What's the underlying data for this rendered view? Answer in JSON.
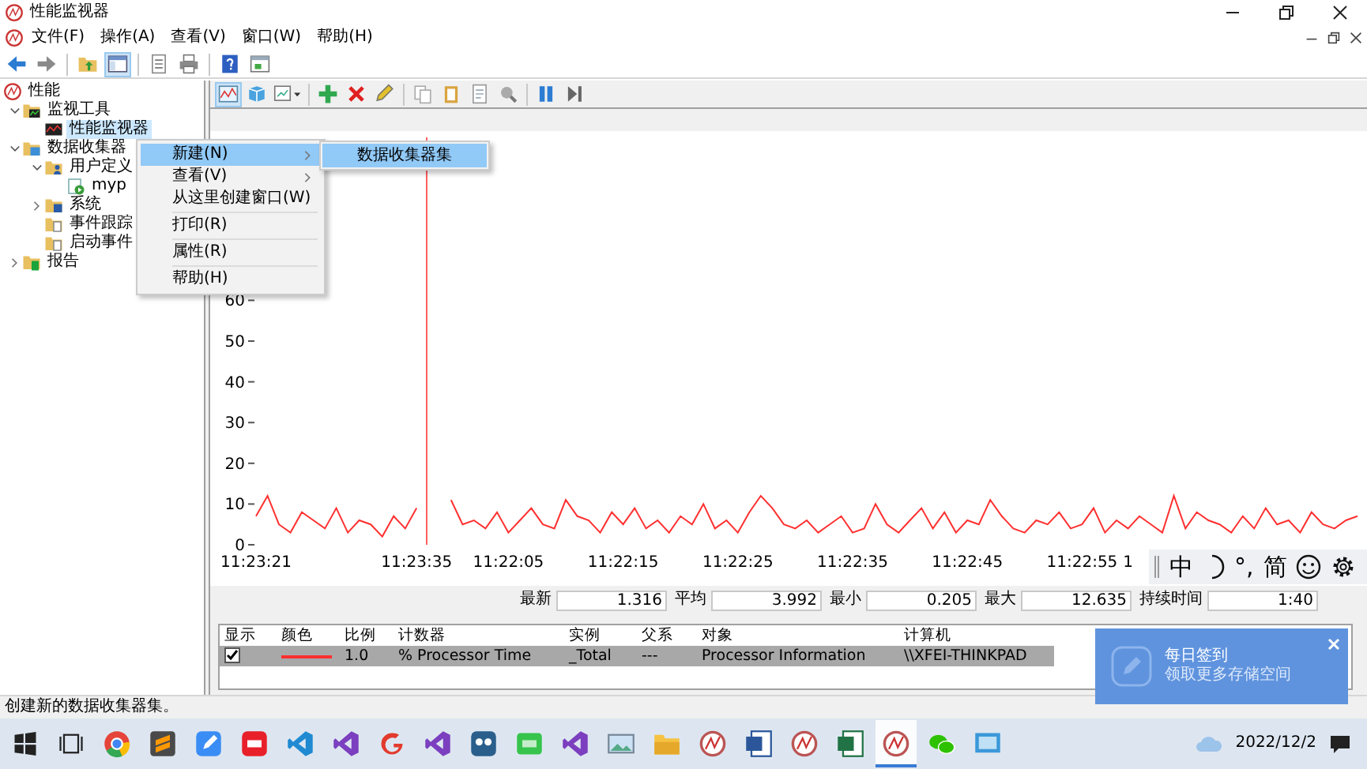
{
  "window": {
    "title": "性能监视器"
  },
  "menu": [
    "文件(F)",
    "操作(A)",
    "查看(V)",
    "窗口(W)",
    "帮助(H)"
  ],
  "main_toolbar": [
    {
      "kind": "back",
      "pressed": false
    },
    {
      "kind": "forward",
      "pressed": false
    },
    {
      "kind": "separator"
    },
    {
      "kind": "upfolder",
      "pressed": false
    },
    {
      "kind": "tree",
      "pressed": true
    },
    {
      "kind": "separator"
    },
    {
      "kind": "list",
      "pressed": false
    },
    {
      "kind": "print",
      "pressed": false
    },
    {
      "kind": "separator"
    },
    {
      "kind": "help",
      "pressed": false
    },
    {
      "kind": "mmcwin",
      "pressed": false
    }
  ],
  "tree": [
    {
      "label": "性能",
      "kind": "perf",
      "selected": false,
      "children": [
        {
          "label": "监视工具",
          "kind": "toolsfolder",
          "selected": false,
          "expanded": true,
          "children": [
            {
              "label": "性能监视器",
              "kind": "monitor",
              "selected": true
            }
          ]
        },
        {
          "label": "数据收集器",
          "kind": "datafolder",
          "selected": false,
          "expanded": true,
          "children": [
            {
              "label": "用户定义",
              "kind": "userfolder",
              "selected": false,
              "expanded": true,
              "children": [
                {
                  "label": "myp",
                  "kind": "dataset",
                  "selected": false
                }
              ]
            },
            {
              "label": "系统",
              "kind": "systemfolder",
              "selected": false,
              "expanded": false
            },
            {
              "label": "事件跟踪",
              "kind": "tracefolder",
              "selected": false
            },
            {
              "label": "启动事件",
              "kind": "tracefolder",
              "selected": false
            }
          ]
        },
        {
          "label": "报告",
          "kind": "reportfolder",
          "selected": false,
          "expanded": false
        }
      ]
    }
  ],
  "graph_toolbar": [
    {
      "kind": "graph",
      "pressed": true
    },
    {
      "kind": "freeze",
      "pressed": false
    },
    {
      "kind": "graphtype",
      "pressed": false
    },
    {
      "kind": "separator"
    },
    {
      "kind": "add",
      "pressed": false
    },
    {
      "kind": "delete",
      "pressed": false
    },
    {
      "kind": "highlight",
      "pressed": false
    },
    {
      "kind": "separator"
    },
    {
      "kind": "copy",
      "pressed": false
    },
    {
      "kind": "paste",
      "pressed": false
    },
    {
      "kind": "props",
      "pressed": false
    },
    {
      "kind": "zoom",
      "pressed": false
    },
    {
      "kind": "separator"
    },
    {
      "kind": "pause",
      "pressed": false
    },
    {
      "kind": "step",
      "pressed": false
    }
  ],
  "graph": {
    "chart_data": {
      "type": "line",
      "ylim": [
        0,
        100
      ],
      "categories": [
        "11:23:21",
        null,
        null,
        null,
        null,
        null,
        null,
        null,
        null,
        null,
        null,
        null,
        null,
        null,
        "11:23:35",
        null,
        null,
        null,
        null,
        null,
        null,
        null,
        "11:22:05",
        null,
        null,
        null,
        null,
        null,
        null,
        null,
        null,
        null,
        "11:22:15",
        null,
        null,
        null,
        null,
        null,
        null,
        null,
        null,
        null,
        "11:22:25",
        null,
        null,
        null,
        null,
        null,
        null,
        null,
        null,
        null,
        "11:22:35",
        null,
        null,
        null,
        null,
        null,
        null,
        null,
        null,
        null,
        "11:22:45",
        null,
        null,
        null,
        null,
        null,
        null,
        null,
        null,
        null,
        "11:22:55",
        null,
        null,
        null,
        "1",
        null,
        null,
        null,
        null,
        null,
        null,
        null,
        null,
        null,
        null,
        null,
        null,
        null,
        null,
        null,
        null,
        null,
        null,
        null,
        null
      ],
      "yticks": [
        0,
        10,
        20,
        30,
        40,
        50,
        60
      ],
      "series": [
        {
          "color": "#ff3030",
          "values": [
            7,
            12,
            5,
            3,
            8,
            6,
            4,
            9,
            3,
            6,
            5,
            2,
            7,
            4,
            9,
            null,
            null,
            11,
            5,
            6,
            4,
            8,
            3,
            6,
            9,
            5,
            4,
            11,
            7,
            6,
            3,
            8,
            5,
            9,
            4,
            6,
            3,
            7,
            5,
            10,
            4,
            6,
            3,
            8,
            12,
            9,
            5,
            4,
            6,
            3,
            5,
            7,
            3,
            4,
            10,
            5,
            3,
            6,
            9,
            4,
            8,
            3,
            6,
            5,
            11,
            7,
            4,
            3,
            6,
            5,
            8,
            4,
            5,
            9,
            3,
            6,
            4,
            7,
            5,
            3,
            12,
            4,
            8,
            6,
            5,
            3,
            7,
            4,
            9,
            5,
            6,
            3,
            8,
            5,
            4,
            6,
            7
          ]
        }
      ]
    }
  },
  "stats": [
    {
      "label": "最新",
      "value": "1.316"
    },
    {
      "label": "平均",
      "value": "3.992"
    },
    {
      "label": "最小",
      "value": "0.205"
    },
    {
      "label": "最大",
      "value": "12.635"
    },
    {
      "label": "持续时间",
      "value": "1:40"
    }
  ],
  "counters": {
    "columns": [
      "显示",
      "颜色",
      "比例",
      "计数器",
      "实例",
      "父系",
      "对象",
      "计算机"
    ],
    "rows": [
      {
        "selected": true,
        "cells": [
          {
            "kind": "checkbox",
            "checked": true
          },
          {
            "kind": "swatch",
            "color": "#ff3030"
          },
          {
            "kind": "text",
            "text": "1.0"
          },
          {
            "kind": "text",
            "text": "% Processor Time"
          },
          {
            "kind": "text",
            "text": "_Total"
          },
          {
            "kind": "text",
            "text": "---"
          },
          {
            "kind": "text",
            "text": "Processor Information"
          },
          {
            "kind": "text",
            "text": "\\\\XFEI-THINKPAD"
          }
        ]
      }
    ]
  },
  "context_menu": {
    "items": [
      {
        "kind": "item",
        "label": "新建(N)",
        "submenu": true,
        "selected": true
      },
      {
        "kind": "item",
        "label": "查看(V)",
        "submenu": true,
        "selected": false
      },
      {
        "kind": "item",
        "label": "从这里创建窗口(W)",
        "submenu": false,
        "selected": false
      },
      {
        "kind": "separator"
      },
      {
        "kind": "item",
        "label": "打印(R)",
        "submenu": false,
        "selected": false
      },
      {
        "kind": "separator"
      },
      {
        "kind": "item",
        "label": "属性(R)",
        "submenu": false,
        "selected": false
      },
      {
        "kind": "separator"
      },
      {
        "kind": "item",
        "label": "帮助(H)",
        "submenu": false,
        "selected": false
      }
    ],
    "submenu": [
      {
        "label": "数据收集器集",
        "selected": true
      }
    ]
  },
  "ime_bar": [
    {
      "kind": "grip"
    },
    {
      "kind": "text",
      "text": "中"
    },
    {
      "kind": "moon"
    },
    {
      "kind": "text",
      "text": "°,"
    },
    {
      "kind": "text",
      "text": "简"
    },
    {
      "kind": "smiley"
    },
    {
      "kind": "gear"
    }
  ],
  "notification": {
    "title": "每日签到",
    "text": "领取更多存储空间"
  },
  "status_bar": "创建新的数据收集器集。",
  "taskbar": [
    {
      "kind": "start",
      "active": false
    },
    {
      "kind": "taskview",
      "active": false
    },
    {
      "kind": "chrome",
      "active": false
    },
    {
      "kind": "sublime",
      "active": false
    },
    {
      "kind": "bluenote",
      "active": false
    },
    {
      "kind": "redapp",
      "active": false
    },
    {
      "kind": "vscode",
      "active": false
    },
    {
      "kind": "vs",
      "active": false
    },
    {
      "kind": "redg",
      "active": false
    },
    {
      "kind": "vs",
      "active": false
    },
    {
      "kind": "face",
      "active": false
    },
    {
      "kind": "qc",
      "active": false
    },
    {
      "kind": "vs",
      "active": false
    },
    {
      "kind": "photos",
      "active": false
    },
    {
      "kind": "folder",
      "active": false
    },
    {
      "kind": "perf",
      "active": false
    },
    {
      "kind": "word",
      "active": false
    },
    {
      "kind": "perf",
      "active": false
    },
    {
      "kind": "excel",
      "active": false
    },
    {
      "kind": "perf",
      "active": true
    },
    {
      "kind": "wechat",
      "active": false
    },
    {
      "kind": "remote",
      "active": false
    }
  ],
  "tray": {
    "date": "2022/12/2"
  }
}
